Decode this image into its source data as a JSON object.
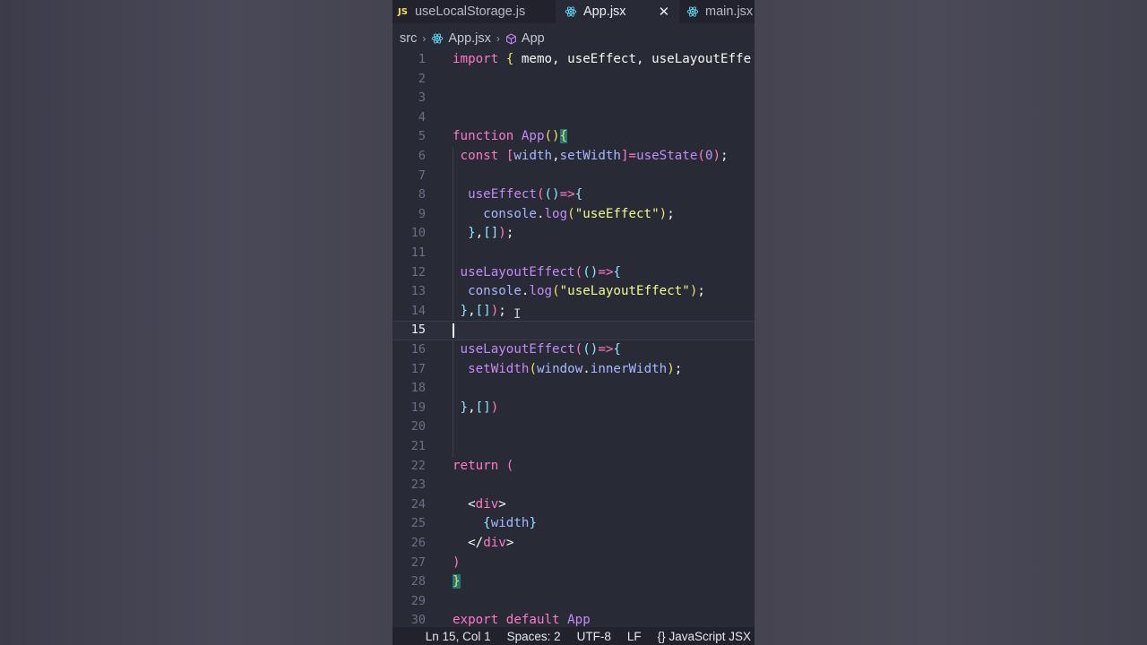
{
  "tabs": [
    {
      "badge": "JS",
      "label": "useLocalStorage.js",
      "icon": "js-file-icon",
      "active": false
    },
    {
      "label": "App.jsx",
      "icon": "react-icon",
      "active": true,
      "close": "✕"
    },
    {
      "label": "main.jsx",
      "icon": "react-icon",
      "active": false
    }
  ],
  "breadcrumb": {
    "folder": "src",
    "file": "App.jsx",
    "symbol": "App",
    "separator": "›"
  },
  "editor": {
    "current_line": 15,
    "lines": [
      {
        "n": "1",
        "tokens": [
          [
            "kw",
            "import"
          ],
          [
            "pun",
            " "
          ],
          [
            "br1",
            "{"
          ],
          [
            "pun",
            " memo, useEffect, useLayoutEffe"
          ]
        ]
      },
      {
        "n": "2",
        "tokens": []
      },
      {
        "n": "3",
        "tokens": []
      },
      {
        "n": "4",
        "tokens": []
      },
      {
        "n": "5",
        "tokens": [
          [
            "kw",
            "function"
          ],
          [
            "pun",
            " "
          ],
          [
            "fn2",
            "App"
          ],
          [
            "br1",
            "()"
          ],
          [
            "br1 hl",
            "{"
          ]
        ]
      },
      {
        "n": "6",
        "tokens": [
          [
            "pun",
            " "
          ],
          [
            "kw",
            "const"
          ],
          [
            "pun",
            " "
          ],
          [
            "br2",
            "["
          ],
          [
            "var",
            "width"
          ],
          [
            "pun",
            ","
          ],
          [
            "var",
            "setWidth"
          ],
          [
            "br2",
            "]"
          ],
          [
            "op",
            "="
          ],
          [
            "fn2",
            "useState"
          ],
          [
            "br2",
            "("
          ],
          [
            "num",
            "0"
          ],
          [
            "br2",
            ")"
          ],
          [
            "pun",
            ";"
          ]
        ]
      },
      {
        "n": "7",
        "tokens": []
      },
      {
        "n": "8",
        "tokens": [
          [
            "pun",
            "  "
          ],
          [
            "fn2",
            "useEffect"
          ],
          [
            "br2",
            "("
          ],
          [
            "br3",
            "()"
          ],
          [
            "op",
            "=>"
          ],
          [
            "br3",
            "{"
          ]
        ]
      },
      {
        "n": "9",
        "tokens": [
          [
            "pun",
            "    "
          ],
          [
            "var",
            "console"
          ],
          [
            "pun",
            "."
          ],
          [
            "fn2",
            "log"
          ],
          [
            "br1",
            "("
          ],
          [
            "str",
            "\"useEffect\""
          ],
          [
            "br1",
            ")"
          ],
          [
            "pun",
            ";"
          ]
        ]
      },
      {
        "n": "10",
        "tokens": [
          [
            "pun",
            "  "
          ],
          [
            "br3",
            "}"
          ],
          [
            "pun",
            ","
          ],
          [
            "br3",
            "[]"
          ],
          [
            "br2",
            ")"
          ],
          [
            "pun",
            ";"
          ]
        ]
      },
      {
        "n": "11",
        "tokens": []
      },
      {
        "n": "12",
        "tokens": [
          [
            "pun",
            " "
          ],
          [
            "fn2",
            "useLayoutEffect"
          ],
          [
            "br2",
            "("
          ],
          [
            "br3",
            "()"
          ],
          [
            "op",
            "=>"
          ],
          [
            "br3",
            "{"
          ]
        ]
      },
      {
        "n": "13",
        "tokens": [
          [
            "pun",
            "  "
          ],
          [
            "var",
            "console"
          ],
          [
            "pun",
            "."
          ],
          [
            "fn2",
            "log"
          ],
          [
            "br1",
            "("
          ],
          [
            "str",
            "\"useLayoutEffect\""
          ],
          [
            "br1",
            ")"
          ],
          [
            "pun",
            ";"
          ]
        ]
      },
      {
        "n": "14",
        "tokens": [
          [
            "pun",
            " "
          ],
          [
            "br3",
            "}"
          ],
          [
            "pun",
            ","
          ],
          [
            "br3",
            "[]"
          ],
          [
            "br2",
            ")"
          ],
          [
            "pun",
            ";"
          ]
        ]
      },
      {
        "n": "15",
        "tokens": []
      },
      {
        "n": "16",
        "tokens": [
          [
            "pun",
            " "
          ],
          [
            "fn2",
            "useLayoutEffect"
          ],
          [
            "br2",
            "("
          ],
          [
            "br3",
            "()"
          ],
          [
            "op",
            "=>"
          ],
          [
            "br3",
            "{"
          ]
        ]
      },
      {
        "n": "17",
        "tokens": [
          [
            "pun",
            "  "
          ],
          [
            "fn2",
            "setWidth"
          ],
          [
            "br1",
            "("
          ],
          [
            "var",
            "window"
          ],
          [
            "pun",
            "."
          ],
          [
            "var",
            "innerWidth"
          ],
          [
            "br1",
            ")"
          ],
          [
            "pun",
            ";"
          ]
        ]
      },
      {
        "n": "18",
        "tokens": []
      },
      {
        "n": "19",
        "tokens": [
          [
            "pun",
            " "
          ],
          [
            "br3",
            "}"
          ],
          [
            "pun",
            ","
          ],
          [
            "br3",
            "[]"
          ],
          [
            "br2",
            ")"
          ]
        ]
      },
      {
        "n": "20",
        "tokens": []
      },
      {
        "n": "21",
        "tokens": []
      },
      {
        "n": "22",
        "tokens": [
          [
            "kw",
            "return"
          ],
          [
            "pun",
            " "
          ],
          [
            "br2",
            "("
          ]
        ]
      },
      {
        "n": "23",
        "tokens": []
      },
      {
        "n": "24",
        "tokens": [
          [
            "pun",
            "  "
          ],
          [
            "pun",
            "<"
          ],
          [
            "tag",
            "div"
          ],
          [
            "pun",
            ">"
          ]
        ]
      },
      {
        "n": "25",
        "tokens": [
          [
            "pun",
            "    "
          ],
          [
            "br3",
            "{"
          ],
          [
            "var",
            "width"
          ],
          [
            "br3",
            "}"
          ]
        ]
      },
      {
        "n": "26",
        "tokens": [
          [
            "pun",
            "  "
          ],
          [
            "pun",
            "</"
          ],
          [
            "tag",
            "div"
          ],
          [
            "pun",
            ">"
          ]
        ]
      },
      {
        "n": "27",
        "tokens": [
          [
            "br2",
            ")"
          ]
        ]
      },
      {
        "n": "28",
        "tokens": [
          [
            "br1 hl",
            "}"
          ]
        ]
      },
      {
        "n": "29",
        "tokens": []
      },
      {
        "n": "30",
        "tokens": [
          [
            "kw",
            "export"
          ],
          [
            "pun",
            " "
          ],
          [
            "kw",
            "default"
          ],
          [
            "pun",
            " "
          ],
          [
            "fn2",
            "App"
          ]
        ]
      }
    ]
  },
  "statusbar": {
    "position": "Ln 15, Col 1",
    "spaces": "Spaces: 2",
    "encoding": "UTF-8",
    "eol": "LF",
    "language_icon": "{}",
    "language": "JavaScript JSX"
  },
  "colors": {
    "editor_bg": "#282a36",
    "keyword": "#ff79c6",
    "function": "#c38bf5",
    "string": "#f1fa8c",
    "variable": "#a8b8ff"
  }
}
